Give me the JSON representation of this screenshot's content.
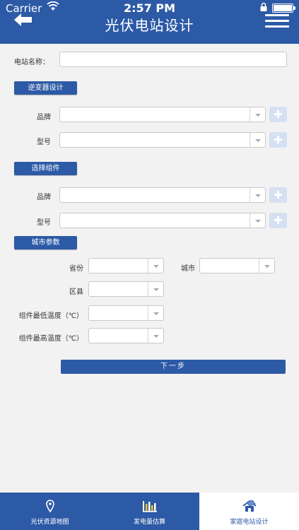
{
  "status": {
    "carrier": "Carrier",
    "time": "2:57 PM"
  },
  "header": {
    "title": "光伏电站设计"
  },
  "station": {
    "name_label": "电站名称：",
    "name_value": ""
  },
  "inverter": {
    "section_label": "逆变器设计",
    "brand_label": "品牌",
    "model_label": "型号"
  },
  "module": {
    "section_label": "选择组件",
    "brand_label": "品牌",
    "model_label": "型号"
  },
  "city": {
    "section_label": "城市参数",
    "province_label": "省份",
    "city_label": "城市",
    "district_label": "区县",
    "min_temp_label": "组件最低温度（℃）",
    "max_temp_label": "组件最高温度（℃）"
  },
  "next_button": {
    "label": "下一步"
  },
  "tabs": [
    {
      "label": "光伏资源地图",
      "icon": "map-pin-icon"
    },
    {
      "label": "发电量估算",
      "icon": "bar-chart-icon"
    },
    {
      "label": "家庭电站设计",
      "icon": "house-solar-icon"
    }
  ],
  "colors": {
    "brand": "#2d5aa6",
    "plus_button": "#d5e0f3",
    "background": "#f2f2f2"
  }
}
